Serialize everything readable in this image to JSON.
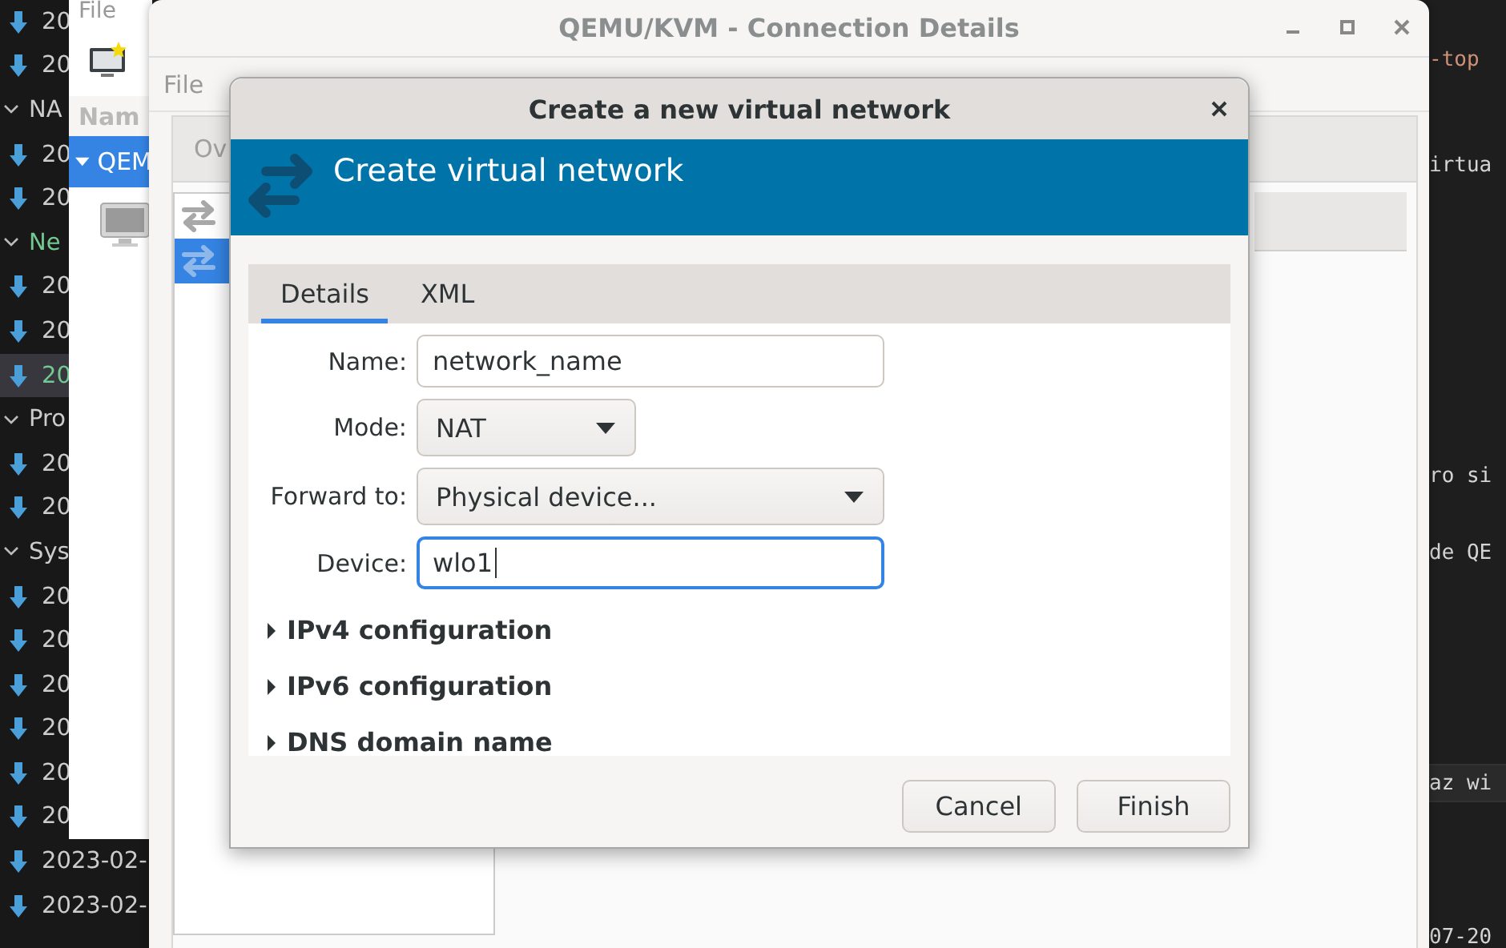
{
  "terminal_sidebar": {
    "rows": [
      {
        "kind": "item",
        "label": "20",
        "selected": false
      },
      {
        "kind": "item",
        "label": "20",
        "selected": false
      },
      {
        "kind": "group",
        "label": "NA",
        "active": false
      },
      {
        "kind": "item",
        "label": "20",
        "selected": false
      },
      {
        "kind": "item",
        "label": "20",
        "selected": false
      },
      {
        "kind": "group",
        "label": "Ne",
        "active": true
      },
      {
        "kind": "item",
        "label": "20",
        "selected": false
      },
      {
        "kind": "item",
        "label": "20",
        "selected": false
      },
      {
        "kind": "item",
        "label": "20",
        "selected": true
      },
      {
        "kind": "group",
        "label": "Pro",
        "active": false
      },
      {
        "kind": "item",
        "label": "20",
        "selected": false
      },
      {
        "kind": "item",
        "label": "20",
        "selected": false
      },
      {
        "kind": "group",
        "label": "Sys",
        "active": false
      },
      {
        "kind": "item",
        "label": "20",
        "selected": false
      },
      {
        "kind": "item",
        "label": "20",
        "selected": false
      },
      {
        "kind": "item",
        "label": "20",
        "selected": false
      },
      {
        "kind": "item",
        "label": "20",
        "selected": false
      },
      {
        "kind": "item",
        "label": "20",
        "selected": false
      },
      {
        "kind": "item",
        "label": "20",
        "selected": false
      },
      {
        "kind": "item",
        "label": "2023-02-",
        "selected": false
      },
      {
        "kind": "item",
        "label": "2023-02-",
        "selected": false
      }
    ]
  },
  "editor_fragments": [
    {
      "text": "-top",
      "color": "#ce9178",
      "current_line": false
    },
    {
      "text": "irtua",
      "color": "#d4d4d4",
      "current_line": false
    },
    {
      "text": "ro si",
      "color": "#d4d4d4",
      "current_line": false
    },
    {
      "text": "de QE",
      "color": "#d4d4d4",
      "current_line": false
    },
    {
      "text": "az wi",
      "color": "#d4d4d4",
      "current_line": true
    },
    {
      "text": "07-20",
      "color": "#d4d4d4",
      "current_line": false
    }
  ],
  "main_window": {
    "menu": "File",
    "column_header": "Nam",
    "connections": [
      {
        "label": "QEM",
        "selected": true,
        "expanded": true
      }
    ]
  },
  "connection_details": {
    "title": "QEMU/KVM - Connection Details",
    "menu": "File",
    "tabs": [
      {
        "label": "Ov",
        "selected": false
      }
    ],
    "networks": [
      {
        "selected": false
      },
      {
        "selected": true
      }
    ]
  },
  "dialog": {
    "title": "Create a new virtual network",
    "header": "Create virtual network",
    "tabs": [
      {
        "label": "Details",
        "selected": true
      },
      {
        "label": "XML",
        "selected": false
      }
    ],
    "fields": [
      {
        "kind": "text",
        "label": "Name:",
        "value": "network_name",
        "focused": false
      },
      {
        "kind": "combo",
        "label": "Mode:",
        "value": "NAT"
      },
      {
        "kind": "combo",
        "label": "Forward to:",
        "value": "Physical device..."
      },
      {
        "kind": "text",
        "label": "Device:",
        "value": "wlo1",
        "focused": true
      }
    ],
    "expanders": [
      {
        "label": "IPv4 configuration",
        "expanded": false
      },
      {
        "label": "IPv6 configuration",
        "expanded": false
      },
      {
        "label": "DNS domain name",
        "expanded": false
      }
    ],
    "buttons": [
      "Cancel",
      "Finish"
    ]
  }
}
